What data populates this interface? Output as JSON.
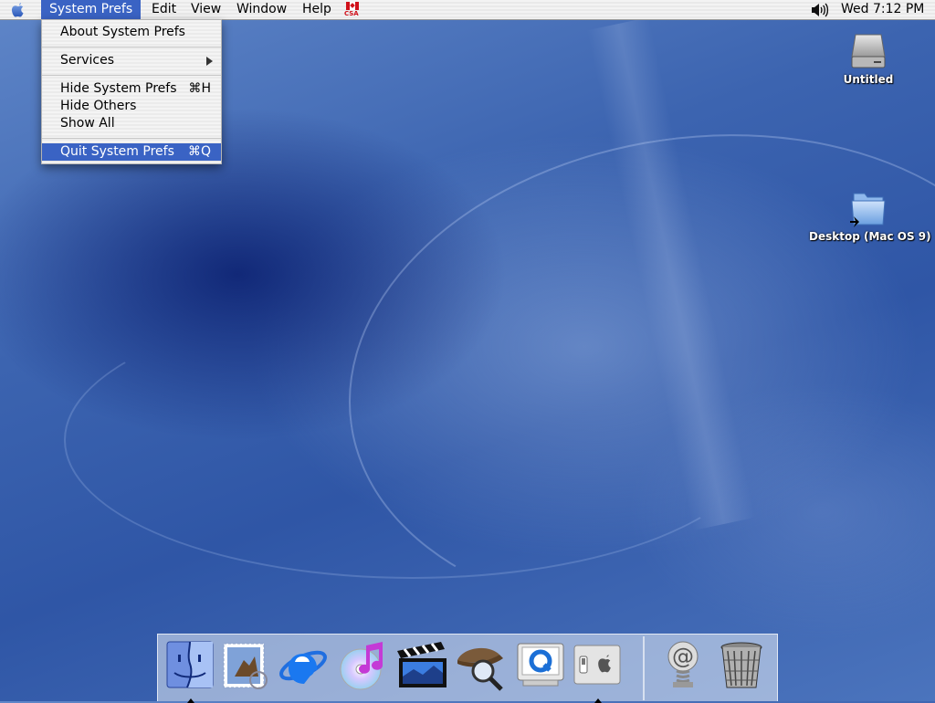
{
  "menubar": {
    "apple_icon": "apple-logo-icon",
    "items": [
      {
        "label": "System Prefs",
        "active": true
      },
      {
        "label": "Edit"
      },
      {
        "label": "View"
      },
      {
        "label": "Window"
      },
      {
        "label": "Help"
      }
    ],
    "csa_label": "CSA",
    "volume_icon": "speaker-volume-icon",
    "clock": "Wed 7:12 PM"
  },
  "app_menu": {
    "items": [
      {
        "label": "About System Prefs",
        "shortcut": ""
      },
      {
        "label": "Services",
        "submenu": true
      },
      {
        "label": "Hide System Prefs",
        "shortcut": "⌘H"
      },
      {
        "label": "Hide Others",
        "shortcut": ""
      },
      {
        "label": "Show All",
        "shortcut": ""
      },
      {
        "label": "Quit System Prefs",
        "shortcut": "⌘Q",
        "highlighted": true
      }
    ]
  },
  "desktop": {
    "icons": [
      {
        "label": "Untitled",
        "icon": "hard-drive-icon"
      },
      {
        "label": "Desktop (Mac OS 9)",
        "icon": "folder-alias-icon"
      }
    ]
  },
  "dock": {
    "apps": [
      {
        "icon": "finder-icon",
        "running": true
      },
      {
        "icon": "mail-icon",
        "running": false
      },
      {
        "icon": "internet-explorer-icon",
        "running": false
      },
      {
        "icon": "itunes-icon",
        "running": false
      },
      {
        "icon": "imovie-icon",
        "running": false
      },
      {
        "icon": "sherlock-icon",
        "running": false
      },
      {
        "icon": "quicktime-icon",
        "running": false
      },
      {
        "icon": "system-preferences-icon",
        "running": true
      },
      {
        "icon": "mac-os-x-mail-spring-icon",
        "running": false
      },
      {
        "icon": "trash-icon",
        "running": false
      }
    ]
  },
  "colors": {
    "menu_highlight": "#3a63c4",
    "desktop_blue": "#3c64b0"
  }
}
